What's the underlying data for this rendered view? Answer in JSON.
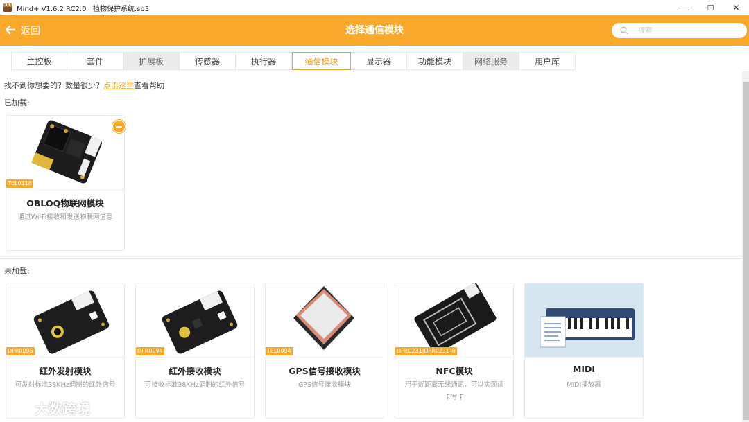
{
  "window": {
    "title": "Mind+ V1.6.2 RC2.0   植物保护系统.sb3",
    "minimize": "—",
    "maximize": "☐",
    "close": "✕"
  },
  "header": {
    "back_label": "返回",
    "title": "选择通信模块",
    "search_placeholder": "搜索"
  },
  "tabs": [
    {
      "label": "主控板",
      "state": "normal"
    },
    {
      "label": "套件",
      "state": "normal"
    },
    {
      "label": "扩展板",
      "state": "disabled"
    },
    {
      "label": "传感器",
      "state": "normal"
    },
    {
      "label": "执行器",
      "state": "normal"
    },
    {
      "label": "通信模块",
      "state": "active"
    },
    {
      "label": "显示器",
      "state": "normal"
    },
    {
      "label": "功能模块",
      "state": "normal"
    },
    {
      "label": "网络服务",
      "state": "disabled"
    },
    {
      "label": "用户库",
      "state": "normal"
    }
  ],
  "help": {
    "prefix": "找不到你想要的？数量很少？",
    "link": "点击这里",
    "suffix": "查看帮助"
  },
  "loaded": {
    "label": "已加载:",
    "cards": [
      {
        "code": "TEL0118",
        "name": "OBLOQ物联网模块",
        "desc": "通过Wi-Fi接收和发送物联网信息"
      }
    ]
  },
  "unloaded": {
    "label": "未加载:",
    "cards": [
      {
        "code": "DFR0095",
        "name": "红外发射模块",
        "desc": "可发射标准38KHz调制的红外信号"
      },
      {
        "code": "DFR0094",
        "name": "红外接收模块",
        "desc": "可接收标准38KHz调制的红外信号"
      },
      {
        "code": "TEL0094",
        "name": "GPS信号接收模块",
        "desc": "GPS信号接收模块"
      },
      {
        "code": "DFR0231|DFR0231-H",
        "name": "NFC模块",
        "desc": "用于近距离无线通讯，可以实现读卡写卡"
      },
      {
        "code": "",
        "name": "MIDI",
        "desc": "MIDI播放器"
      }
    ]
  },
  "watermark": "大数跨境",
  "colors": {
    "accent": "#f8a82a",
    "link": "#f5a623"
  }
}
